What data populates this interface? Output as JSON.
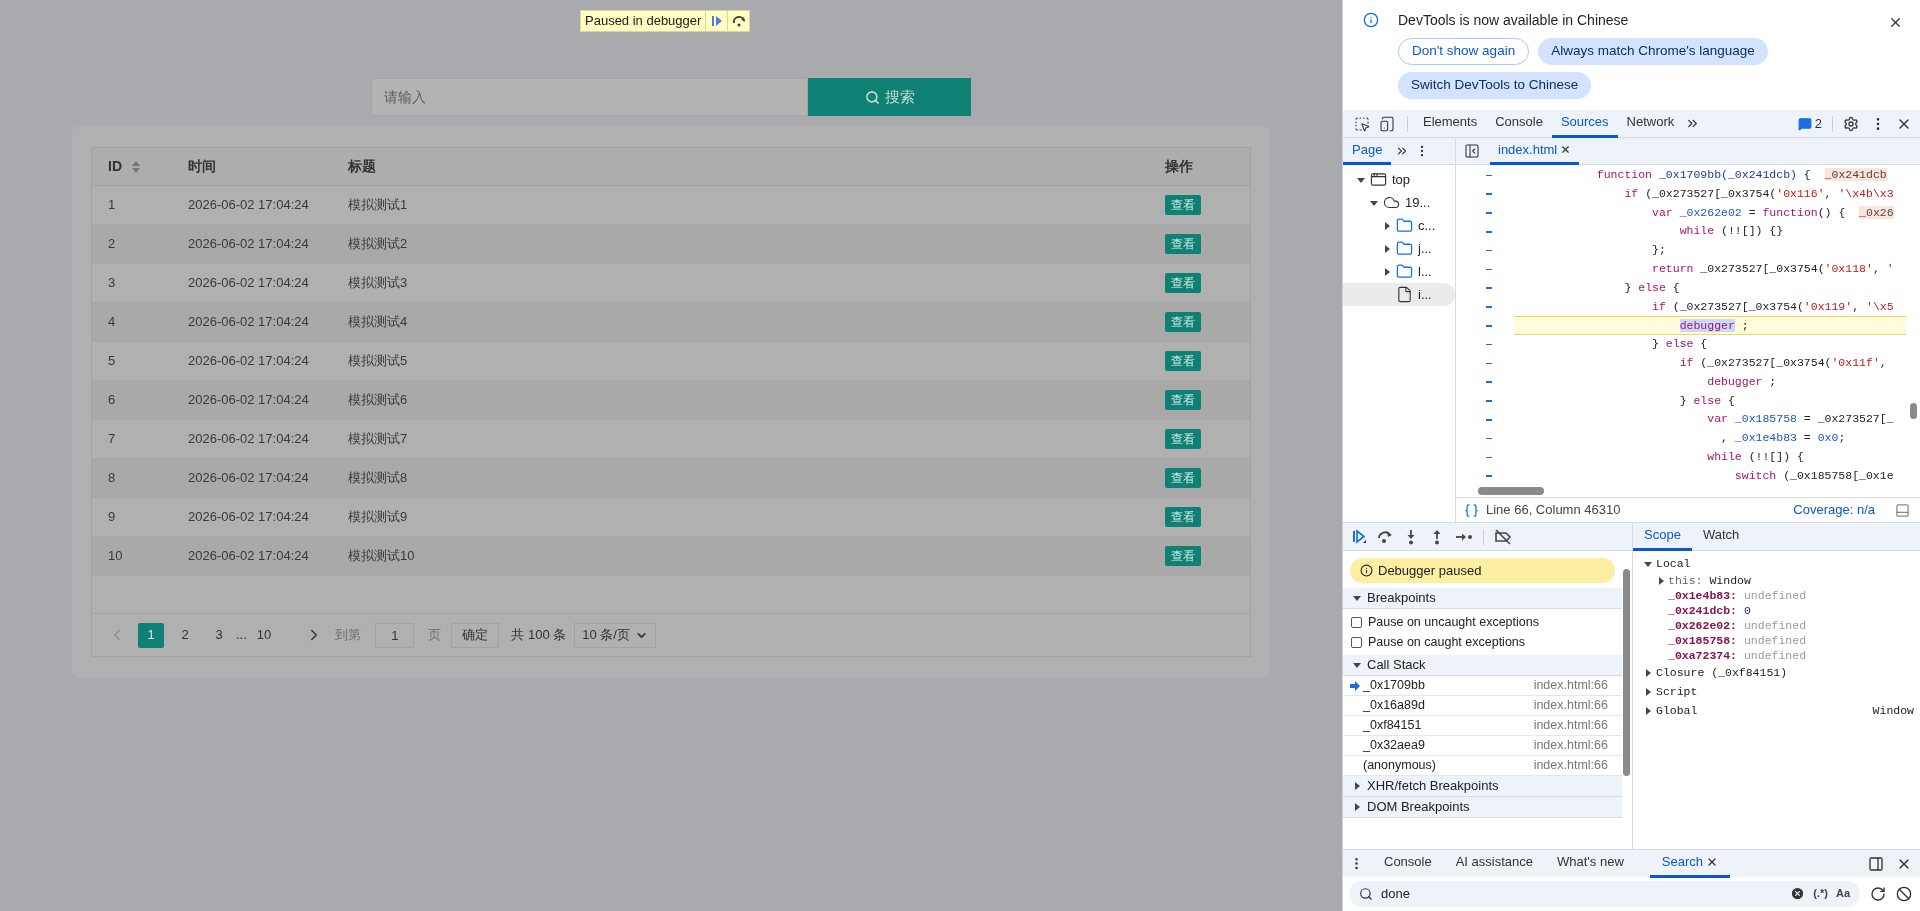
{
  "page": {
    "search": {
      "placeholder": "请输入",
      "button": "搜索"
    },
    "table": {
      "columns": [
        {
          "label": "ID",
          "sortable": true
        },
        {
          "label": "时间",
          "sortable": false
        },
        {
          "label": "标题",
          "sortable": false
        },
        {
          "label": "操作",
          "sortable": false
        }
      ],
      "rows": [
        {
          "id": "1",
          "time": "2026-06-02 17:04:24",
          "title": "模拟测试1",
          "action": "查看"
        },
        {
          "id": "2",
          "time": "2026-06-02 17:04:24",
          "title": "模拟测试2",
          "action": "查看"
        },
        {
          "id": "3",
          "time": "2026-06-02 17:04:24",
          "title": "模拟测试3",
          "action": "查看"
        },
        {
          "id": "4",
          "time": "2026-06-02 17:04:24",
          "title": "模拟测试4",
          "action": "查看"
        },
        {
          "id": "5",
          "time": "2026-06-02 17:04:24",
          "title": "模拟测试5",
          "action": "查看"
        },
        {
          "id": "6",
          "time": "2026-06-02 17:04:24",
          "title": "模拟测试6",
          "action": "查看"
        },
        {
          "id": "7",
          "time": "2026-06-02 17:04:24",
          "title": "模拟测试7",
          "action": "查看"
        },
        {
          "id": "8",
          "time": "2026-06-02 17:04:24",
          "title": "模拟测试8",
          "action": "查看"
        },
        {
          "id": "9",
          "time": "2026-06-02 17:04:24",
          "title": "模拟测试9",
          "action": "查看"
        },
        {
          "id": "10",
          "time": "2026-06-02 17:04:24",
          "title": "模拟测试10",
          "action": "查看"
        }
      ]
    },
    "pagination": {
      "prev": {
        "disabled": true
      },
      "next": {
        "disabled": false
      },
      "pages": [
        {
          "kind": "page",
          "label": "1",
          "selected": true
        },
        {
          "kind": "page",
          "label": "2",
          "selected": false
        },
        {
          "kind": "page",
          "label": "3",
          "selected": false
        },
        {
          "kind": "ellipsis",
          "label": "..."
        },
        {
          "kind": "page",
          "label": "10",
          "selected": false
        }
      ],
      "goto_label": "到第",
      "goto_value": "1",
      "page_unit": "页",
      "confirm": "确定",
      "total": "共 100 条",
      "page_size": "10 条/页"
    }
  },
  "overlay": {
    "text": "Paused in debugger"
  },
  "devtools": {
    "infobar": {
      "message": "DevTools is now available in Chinese",
      "buttons": [
        {
          "label": "Don't show again",
          "kind": "outline"
        },
        {
          "label": "Always match Chrome's language",
          "kind": "filled"
        },
        {
          "label": "Switch DevTools to Chinese",
          "kind": "filled"
        }
      ]
    },
    "tabs": [
      {
        "label": "Elements",
        "selected": false
      },
      {
        "label": "Console",
        "selected": false
      },
      {
        "label": "Sources",
        "selected": true
      },
      {
        "label": "Network",
        "selected": false
      }
    ],
    "issues_count": "2",
    "navigator": {
      "tab": "Page",
      "tree": [
        {
          "label": "top",
          "kind": "frame",
          "expanded": true,
          "selected": false,
          "children": [
            {
              "label": "19...",
              "kind": "cloud",
              "expanded": true,
              "selected": false,
              "children": [
                {
                  "label": "c...",
                  "kind": "folder",
                  "expanded": false,
                  "selected": false
                },
                {
                  "label": "j...",
                  "kind": "folder",
                  "expanded": false,
                  "selected": false
                },
                {
                  "label": "l...",
                  "kind": "folder",
                  "expanded": false,
                  "selected": false
                },
                {
                  "label": "i...",
                  "kind": "file",
                  "selected": true
                }
              ]
            }
          ]
        }
      ]
    },
    "editor": {
      "file_tab": "index.html",
      "lines": [
        {
          "paused": false,
          "tokens": [
            {
              "kind": "kw",
              "text": "            function"
            },
            {
              "kind": "def",
              "text": " _0x1709bb(_0x241dcb)"
            },
            {
              "kind": "plain",
              "text": " {  "
            },
            {
              "kind": "hint",
              "text": "_0x241dcb"
            }
          ]
        },
        {
          "paused": false,
          "tokens": [
            {
              "kind": "kw",
              "text": "                if"
            },
            {
              "kind": "plain",
              "text": " (_0x273527[_0x3754("
            },
            {
              "kind": "str",
              "text": "'0x116'"
            },
            {
              "kind": "plain",
              "text": ", "
            },
            {
              "kind": "str",
              "text": "'\\x4b\\x3"
            }
          ]
        },
        {
          "paused": false,
          "tokens": [
            {
              "kind": "kw",
              "text": "                    var"
            },
            {
              "kind": "var",
              "text": " _0x262e02"
            },
            {
              "kind": "plain",
              "text": " = "
            },
            {
              "kind": "kw",
              "text": "function"
            },
            {
              "kind": "plain",
              "text": "() {  "
            },
            {
              "kind": "hint",
              "text": "_0x26"
            }
          ]
        },
        {
          "paused": false,
          "tokens": [
            {
              "kind": "kw",
              "text": "                        while"
            },
            {
              "kind": "plain",
              "text": " (!![]) {}"
            }
          ]
        },
        {
          "paused": false,
          "tokens": [
            {
              "kind": "plain",
              "text": "                    };"
            }
          ]
        },
        {
          "paused": false,
          "tokens": [
            {
              "kind": "kw",
              "text": "                    return"
            },
            {
              "kind": "plain",
              "text": " _0x273527[_0x3754("
            },
            {
              "kind": "str",
              "text": "'0x118'"
            },
            {
              "kind": "plain",
              "text": ", "
            },
            {
              "kind": "str",
              "text": "'"
            }
          ]
        },
        {
          "paused": false,
          "tokens": [
            {
              "kind": "plain",
              "text": "                } "
            },
            {
              "kind": "kw",
              "text": "else"
            },
            {
              "kind": "plain",
              "text": " {"
            }
          ]
        },
        {
          "paused": false,
          "tokens": [
            {
              "kind": "kw",
              "text": "                    if"
            },
            {
              "kind": "plain",
              "text": " (_0x273527[_0x3754("
            },
            {
              "kind": "str",
              "text": "'0x119'"
            },
            {
              "kind": "plain",
              "text": ", "
            },
            {
              "kind": "str",
              "text": "'\\x5"
            }
          ]
        },
        {
          "paused": true,
          "tokens": [
            {
              "kind": "kwsel",
              "text": "debugger"
            },
            {
              "kind": "plain",
              "text": " ;"
            }
          ]
        },
        {
          "paused": false,
          "tokens": [
            {
              "kind": "plain",
              "text": "                    } "
            },
            {
              "kind": "kw",
              "text": "else"
            },
            {
              "kind": "plain",
              "text": " {"
            }
          ]
        },
        {
          "paused": false,
          "tokens": [
            {
              "kind": "kw",
              "text": "                        if"
            },
            {
              "kind": "plain",
              "text": " (_0x273527[_0x3754("
            },
            {
              "kind": "str",
              "text": "'0x11f'"
            },
            {
              "kind": "plain",
              "text": ","
            }
          ]
        },
        {
          "paused": false,
          "tokens": [
            {
              "kind": "kw",
              "text": "                            debugger"
            },
            {
              "kind": "plain",
              "text": " ;"
            }
          ]
        },
        {
          "paused": false,
          "tokens": [
            {
              "kind": "plain",
              "text": "                        } "
            },
            {
              "kind": "kw",
              "text": "else"
            },
            {
              "kind": "plain",
              "text": " {"
            }
          ]
        },
        {
          "paused": false,
          "tokens": [
            {
              "kind": "kw",
              "text": "                            var"
            },
            {
              "kind": "var",
              "text": " _0x185758"
            },
            {
              "kind": "plain",
              "text": " = _0x273527[_"
            }
          ]
        },
        {
          "paused": false,
          "tokens": [
            {
              "kind": "plain",
              "text": "                              , "
            },
            {
              "kind": "var",
              "text": "_0x1e4b83"
            },
            {
              "kind": "plain",
              "text": " = "
            },
            {
              "kind": "num",
              "text": "0x0"
            },
            {
              "kind": "plain",
              "text": ";"
            }
          ]
        },
        {
          "paused": false,
          "tokens": [
            {
              "kind": "kw",
              "text": "                            while"
            },
            {
              "kind": "plain",
              "text": " (!![]) {"
            }
          ]
        },
        {
          "paused": false,
          "tokens": [
            {
              "kind": "kw",
              "text": "                                switch"
            },
            {
              "kind": "plain",
              "text": " (_0x185758[_0x1e"
            }
          ]
        }
      ]
    },
    "status": {
      "position": "Line 66, Column 46310",
      "coverage": "Coverage: n/a"
    },
    "paused_banner": "Debugger paused",
    "sections": [
      {
        "kind": "breakpoints",
        "label": "Breakpoints",
        "expanded": true,
        "options": [
          {
            "label": "Pause on uncaught exceptions",
            "checked": false
          },
          {
            "label": "Pause on caught exceptions",
            "checked": false
          }
        ]
      },
      {
        "kind": "callstack",
        "label": "Call Stack",
        "expanded": true,
        "frames": [
          {
            "name": "_0x1709bb",
            "location": "index.html:66",
            "selected": true
          },
          {
            "name": "_0x16a89d",
            "location": "index.html:66",
            "selected": false
          },
          {
            "name": "_0xf84151",
            "location": "index.html:66",
            "selected": false
          },
          {
            "name": "_0x32aea9",
            "location": "index.html:66",
            "selected": false
          },
          {
            "name": "(anonymous)",
            "location": "index.html:66",
            "selected": false
          }
        ]
      },
      {
        "label": "XHR/fetch Breakpoints",
        "expanded": false
      },
      {
        "label": "DOM Breakpoints",
        "expanded": false
      }
    ],
    "scope": {
      "tabs": [
        {
          "label": "Scope",
          "selected": true
        },
        {
          "label": "Watch",
          "selected": false
        }
      ],
      "groups": [
        {
          "label": "Local",
          "expanded": true,
          "vars": [
            {
              "name": "this:",
              "value": "Window",
              "kind": "object"
            },
            {
              "name": "_0x1e4b83:",
              "value": "undefined",
              "kind": "undefined"
            },
            {
              "name": "_0x241dcb:",
              "value": "0",
              "kind": "number"
            },
            {
              "name": "_0x262e02:",
              "value": "undefined",
              "kind": "undefined"
            },
            {
              "name": "_0x185758:",
              "value": "undefined",
              "kind": "undefined"
            },
            {
              "name": "_0xa72374:",
              "value": "undefined",
              "kind": "undefined"
            }
          ]
        },
        {
          "label": "Closure (_0xf84151)",
          "expanded": false
        },
        {
          "label": "Script",
          "expanded": false
        },
        {
          "label": "Global",
          "expanded": false,
          "value": "Window"
        }
      ]
    },
    "drawer": {
      "tabs": [
        {
          "label": "Console",
          "selected": false
        },
        {
          "label": "AI assistance",
          "selected": false
        },
        {
          "label": "What's new",
          "selected": false
        },
        {
          "label": "Search",
          "selected": true
        }
      ],
      "search_value": "done",
      "regex_toggle": "(.*)",
      "case_toggle": "Aa"
    }
  }
}
